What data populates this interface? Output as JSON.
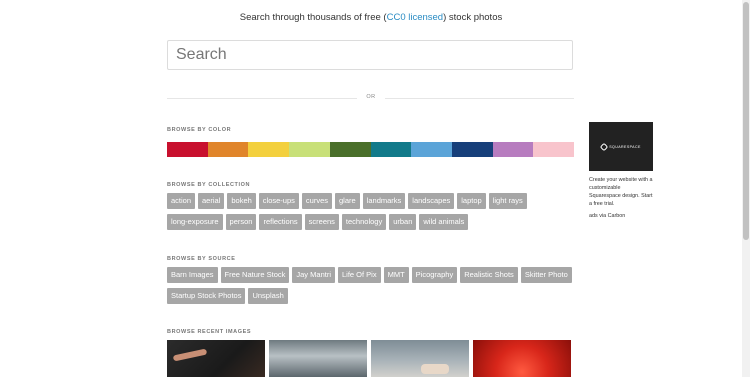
{
  "header": {
    "prefix": "Search through thousands of free (",
    "link": "CC0 licensed",
    "suffix": ") stock photos"
  },
  "search": {
    "placeholder": "Search"
  },
  "divider": {
    "label": "OR"
  },
  "colors": {
    "title": "BROWSE BY COLOR",
    "swatches": [
      "#c8102e",
      "#e0852b",
      "#f3d03e",
      "#c8e078",
      "#4a6f2a",
      "#127a8a",
      "#5ba4d8",
      "#173f7a",
      "#b77cbf",
      "#f8c4cc"
    ]
  },
  "collections": {
    "title": "BROWSE BY COLLECTION",
    "tags": [
      "action",
      "aerial",
      "bokeh",
      "close-ups",
      "curves",
      "glare",
      "landmarks",
      "landscapes",
      "laptop",
      "light rays",
      "long-exposure",
      "person",
      "reflections",
      "screens",
      "technology",
      "urban",
      "wild animals"
    ]
  },
  "sources": {
    "title": "BROWSE BY SOURCE",
    "tags": [
      "Barn Images",
      "Free Nature Stock",
      "Jay Mantri",
      "Life Of Pix",
      "MMT",
      "Picography",
      "Realistic Shots",
      "Skitter Photo",
      "Startup Stock Photos",
      "Unsplash"
    ]
  },
  "recent": {
    "title": "BROWSE RECENT IMAGES"
  },
  "ad": {
    "brand": "SQUARESPACE",
    "logo_icon": "squarespace-logo-icon",
    "text": "Create your website with a customizable Squarespace design. Start a free trial.",
    "via": "ads via Carbon"
  }
}
